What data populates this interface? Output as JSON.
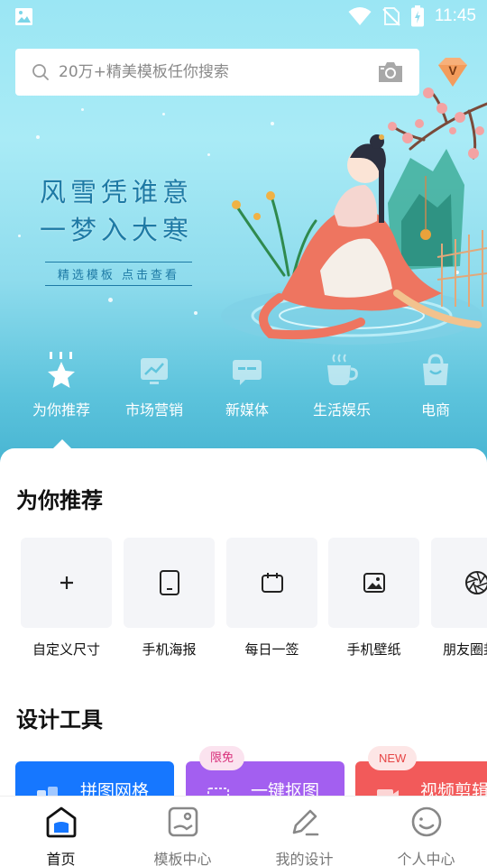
{
  "status_bar": {
    "time": "11:45"
  },
  "search": {
    "placeholder": "20万+精美模板任你搜索"
  },
  "banner": {
    "line1": "风雪凭谁意",
    "line2": "一梦入大寒",
    "sub": "精选模板 点击查看"
  },
  "categories": [
    {
      "label": "为你推荐",
      "icon": "star-icon",
      "active": true
    },
    {
      "label": "市场营销",
      "icon": "chart-icon"
    },
    {
      "label": "新媒体",
      "icon": "message-icon"
    },
    {
      "label": "生活娱乐",
      "icon": "coffee-icon"
    },
    {
      "label": "电商",
      "icon": "shopping-bag-icon"
    }
  ],
  "recommend": {
    "title": "为你推荐",
    "items": [
      {
        "label": "自定义尺寸",
        "icon": "plus-icon"
      },
      {
        "label": "手机海报",
        "icon": "phone-icon"
      },
      {
        "label": "每日一签",
        "icon": "calendar-icon"
      },
      {
        "label": "手机壁纸",
        "icon": "image-icon"
      },
      {
        "label": "朋友圈封面",
        "icon": "aperture-icon"
      }
    ]
  },
  "tools": {
    "title": "设计工具",
    "items": [
      {
        "label": "拼图网格",
        "color": "#1677ff"
      },
      {
        "label": "一键抠图",
        "color": "#a35ff0",
        "badge": "限免"
      },
      {
        "label": "视频剪辑",
        "color": "#f25a5a",
        "badge": "NEW"
      }
    ]
  },
  "bottom_nav": [
    {
      "label": "首页",
      "icon": "home-icon",
      "active": true
    },
    {
      "label": "模板中心",
      "icon": "template-icon"
    },
    {
      "label": "我的设计",
      "icon": "pen-icon"
    },
    {
      "label": "个人中心",
      "icon": "user-icon"
    }
  ],
  "colors": {
    "accent": "#1677ff",
    "hero_top": "#9be6f4",
    "hero_bottom": "#48b5d2"
  }
}
